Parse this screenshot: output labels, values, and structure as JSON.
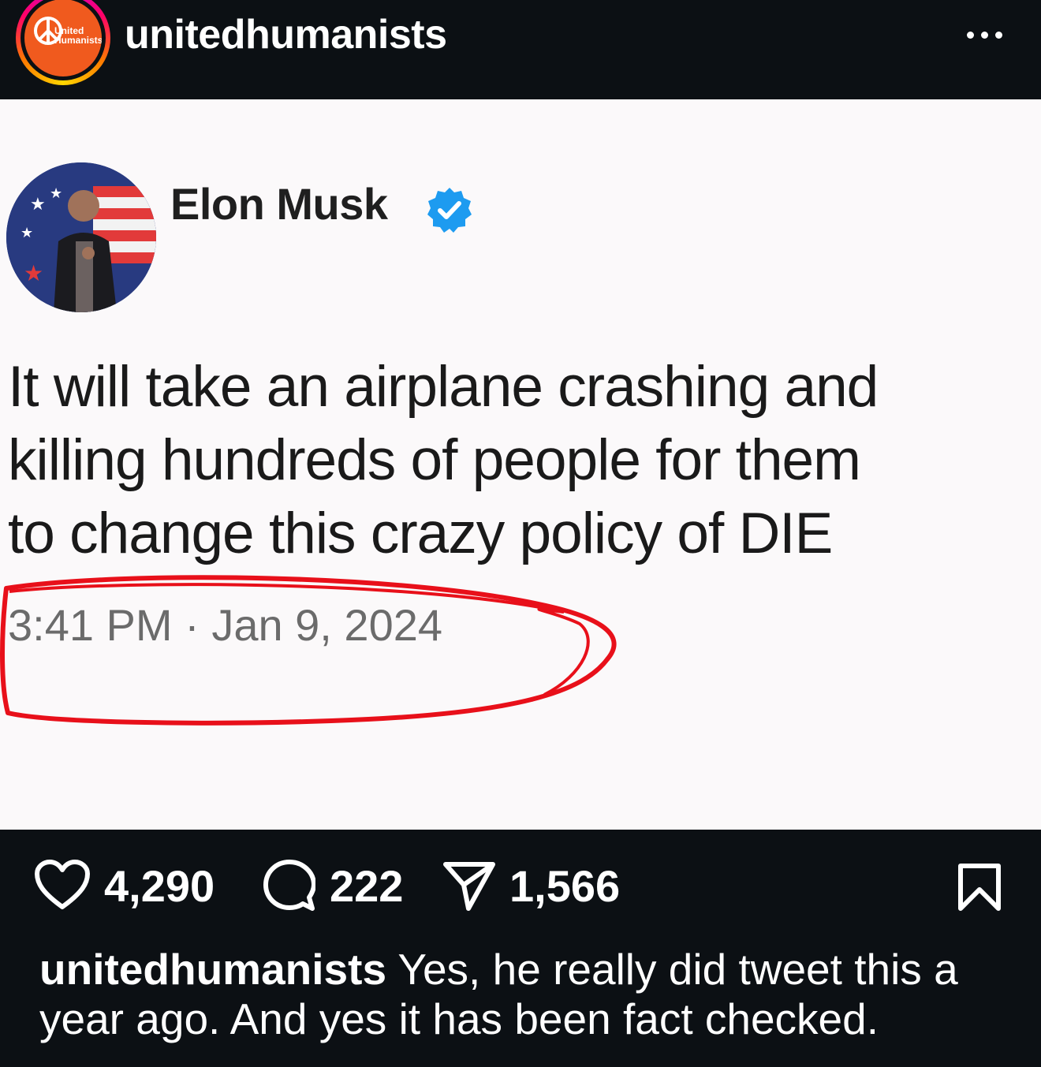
{
  "header": {
    "username": "unitedhumanists",
    "avatar_text_line1": "United",
    "avatar_text_line2": "Humanists"
  },
  "tweet": {
    "author": "Elon Musk",
    "verified": true,
    "lines": [
      "It will take an airplane crashing and",
      "killing hundreds of people for them",
      "to change this crazy policy of DIE"
    ],
    "timestamp": "3:41 PM · Jan 9, 2024",
    "annotation_color": "#e8101a"
  },
  "actions": {
    "likes": "4,290",
    "comments": "222",
    "shares": "1,566"
  },
  "caption": {
    "username": "unitedhumanists",
    "text": "Yes, he really did tweet this a year ago. And yes it has been fact checked."
  },
  "colors": {
    "background": "#0c1014",
    "post_background": "#fbf9fa",
    "verified_blue": "#1d9bf0",
    "avatar_orange": "#f05a1e"
  }
}
